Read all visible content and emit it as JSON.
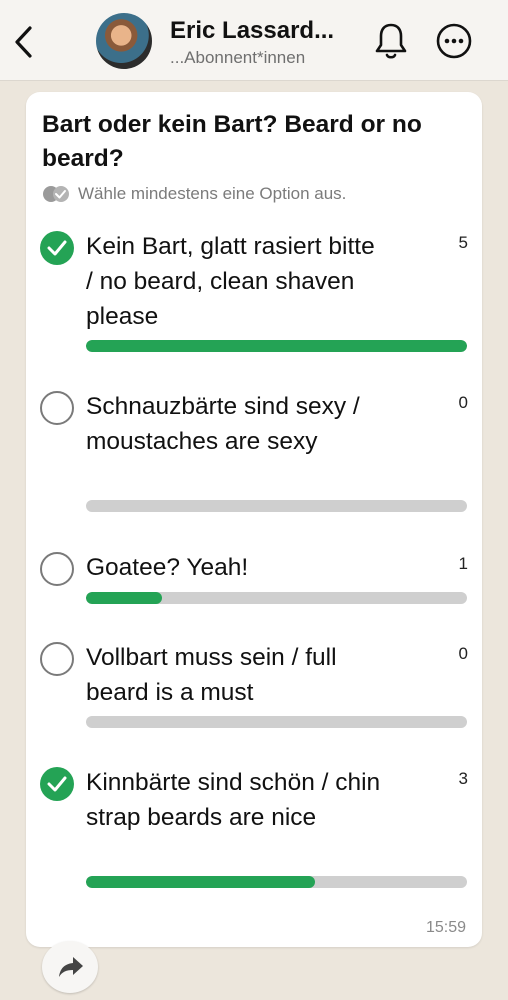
{
  "header": {
    "title": "Eric Lassard...",
    "subtitle": "...Abonnent*innen",
    "icons": [
      "back-chevron-icon",
      "bell-icon",
      "more-options-icon"
    ]
  },
  "poll": {
    "question": "Bart oder kein Bart? Beard or no beard?",
    "hint": "Wähle mindestens eine Option aus.",
    "accent_color": "#24a355",
    "options": [
      {
        "label": "Kein Bart, glatt rasiert bitte / no beard, clean shaven please",
        "count": "5",
        "checked": true,
        "fill": 1.0
      },
      {
        "label": "Schnauzbärte sind sexy / moustaches are sexy",
        "count": "0",
        "checked": false,
        "fill": 0.0
      },
      {
        "label": "Goatee? Yeah!",
        "count": "1",
        "checked": false,
        "fill": 0.2
      },
      {
        "label": "Vollbart muss sein / full beard is a must",
        "count": "0",
        "checked": false,
        "fill": 0.0
      },
      {
        "label": "Kinnbärte sind schön / chin strap beards are nice",
        "count": "3",
        "checked": true,
        "fill": 0.6
      }
    ],
    "time": "15:59"
  }
}
